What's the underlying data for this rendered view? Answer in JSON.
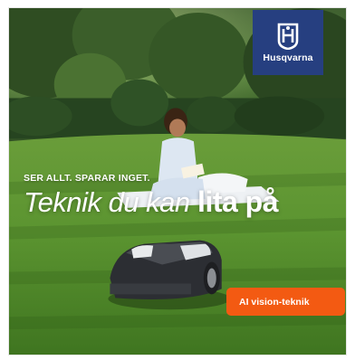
{
  "brand": {
    "name": "Husqvarna",
    "color": "#263f80"
  },
  "headline": {
    "tagline": "SER ALLT. SPARAR INGET.",
    "light_text": "Teknik du kan",
    "bold_text": "lita på"
  },
  "cta": {
    "label": "AI vision-teknik",
    "color": "#f35a12"
  },
  "scene": {
    "icons": [
      "trees",
      "hedge",
      "lawn",
      "person-reading-icon",
      "robotic-lawnmower-icon"
    ]
  }
}
